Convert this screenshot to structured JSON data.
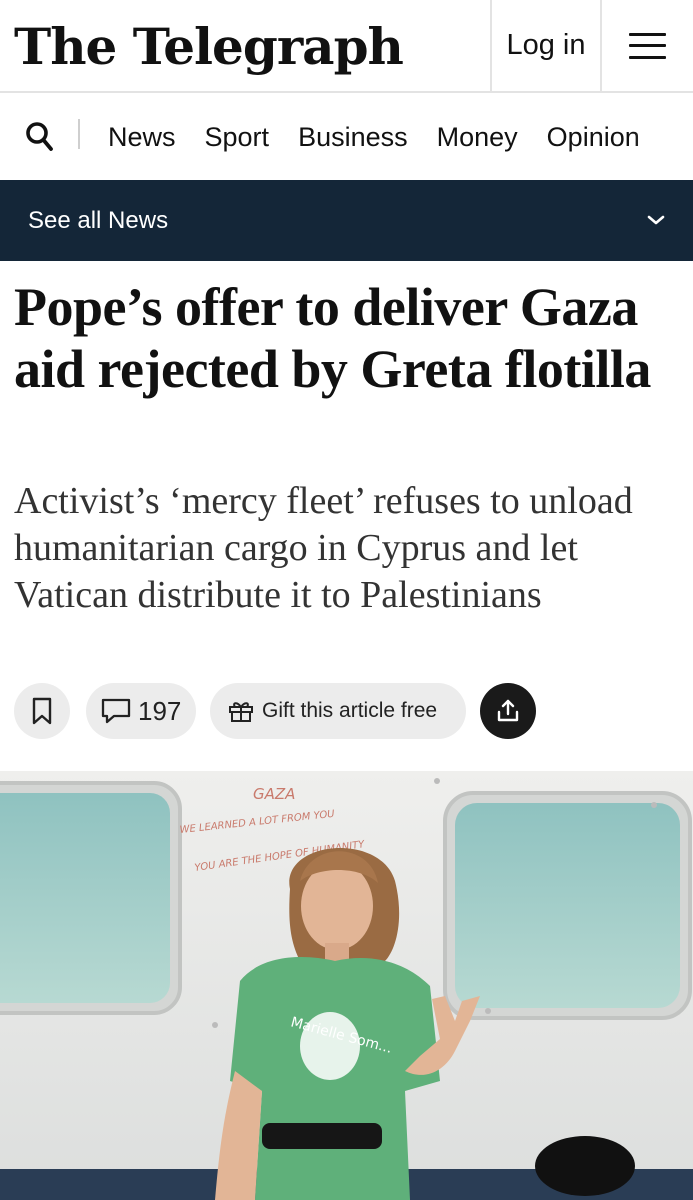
{
  "masthead": {
    "logo_text": "The Telegraph",
    "login_label": "Log in",
    "menu_icon": "hamburger-menu-icon"
  },
  "nav": {
    "search_icon": "search-icon",
    "items": [
      {
        "label": "News"
      },
      {
        "label": "Sport"
      },
      {
        "label": "Business"
      },
      {
        "label": "Money"
      },
      {
        "label": "Opinion"
      }
    ]
  },
  "section_bar": {
    "label": "See all News",
    "icon": "chevron-down-icon",
    "background": "#142638"
  },
  "article": {
    "headline": "Pope’s offer to deliver Gaza aid rejected by Greta flotilla",
    "standfirst": "Activist’s ‘mercy fleet’ refuses to unload humanitarian cargo in Cyprus and let Vatican distribute it to Palestinians",
    "actions": {
      "save_icon": "bookmark-icon",
      "comments_icon": "comment-bubble-icon",
      "comments_count": "197",
      "gift_icon": "gift-icon",
      "gift_label": "Gift this article free",
      "share_icon": "share-icon"
    },
    "photo": {
      "wall_writing": [
        "GAZA",
        "WE LEARNED A LOT FROM YOU",
        "YOU ARE THE HOPE OF HUMANITY"
      ],
      "shirt_text": "Marielle Som..."
    }
  }
}
